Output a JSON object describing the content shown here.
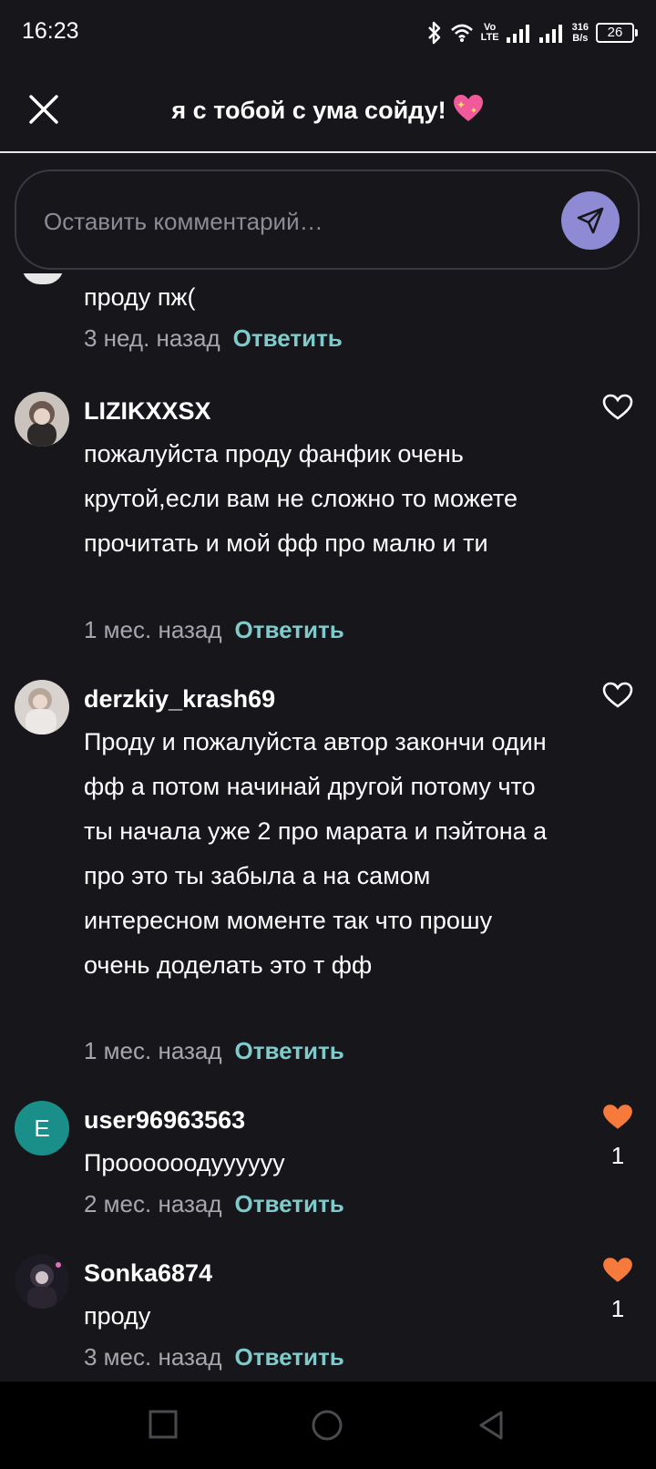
{
  "status_bar": {
    "time": "16:23",
    "volte_top": "Vo",
    "volte_bottom": "LTE",
    "speed_value": "316",
    "speed_unit": "B/s",
    "battery": "26"
  },
  "header": {
    "title": "я с тобой с ума сойду!",
    "close_icon": "close-icon",
    "title_emoji": "sparkling-heart"
  },
  "comment_input": {
    "placeholder": "Оставить комментарий…",
    "send_icon": "send-icon"
  },
  "reply_label": "Ответить",
  "comments": [
    {
      "text": "проду пж(",
      "time": "3 нед. назад"
    },
    {
      "username": "LIZIKXXSX",
      "text": "пожалуйста проду фанфик очень крутой,если вам не сложно то можете прочитать и мой фф про малю и ти",
      "time": "1 мес. назад",
      "liked": false
    },
    {
      "username": "derzkiy_krash69",
      "text": "Проду и пожалуйста автор закончи один фф а потом начинай другой потому что ты начала уже 2 про марата и пэйтона а про это ты забыла а на самом интересном моменте так что прошу очень доделать это т фф",
      "time": "1 мес. назад",
      "liked": false
    },
    {
      "username": "user96963563",
      "avatar_letter": "E",
      "text": "Проооооодууууyу",
      "time": "2 мес. назад",
      "liked": true,
      "likes": "1"
    },
    {
      "username": "Sonka6874",
      "text": "проду",
      "time": "3 мес. назад",
      "liked": true,
      "likes": "1"
    }
  ],
  "colors": {
    "background": "#17161b",
    "accent_reply": "#7fcbcb",
    "like_active": "#f57a3c",
    "send_button": "#8e8ad4"
  }
}
